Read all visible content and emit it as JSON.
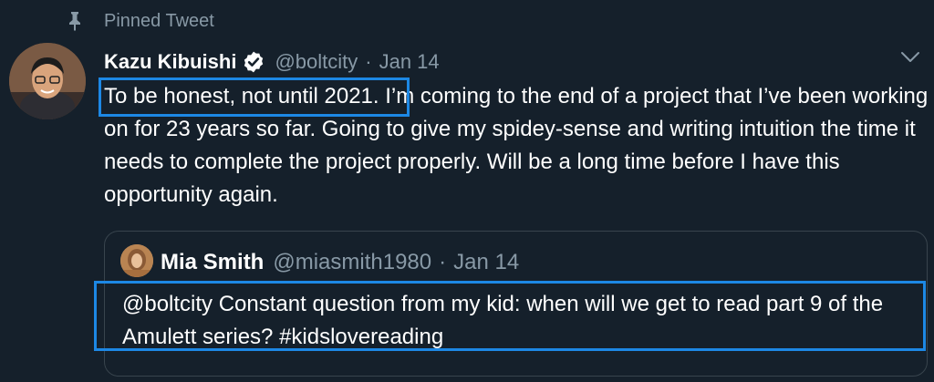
{
  "pinned": {
    "label": "Pinned Tweet",
    "icon": "pin-icon"
  },
  "tweet": {
    "author_name": "Kazu Kibuishi",
    "verified": true,
    "handle": "@boltcity",
    "separator": "·",
    "date": "Jan 14",
    "text_highlighted": "To be honest, not until 2021.",
    "text_rest": " I’m coming to the end of a project that I’ve been working on for 23 years so far. Going to give my spidey-sense and writing intuition the time it needs to complete the project properly. Will be a long time before I have this opportunity again."
  },
  "quoted_tweet": {
    "author_name": "Mia Smith",
    "handle": "@miasmith1980",
    "separator": "·",
    "date": "Jan 14",
    "text": "@boltcity Constant question from my kid: when will we get to read part 9 of the Amulett series? #kidslovereading"
  },
  "colors": {
    "background": "#15202b",
    "secondary_text": "#8899a6",
    "highlight_box": "#1d88e5",
    "verified_badge": "#ffffff",
    "quote_border": "#38444d"
  }
}
